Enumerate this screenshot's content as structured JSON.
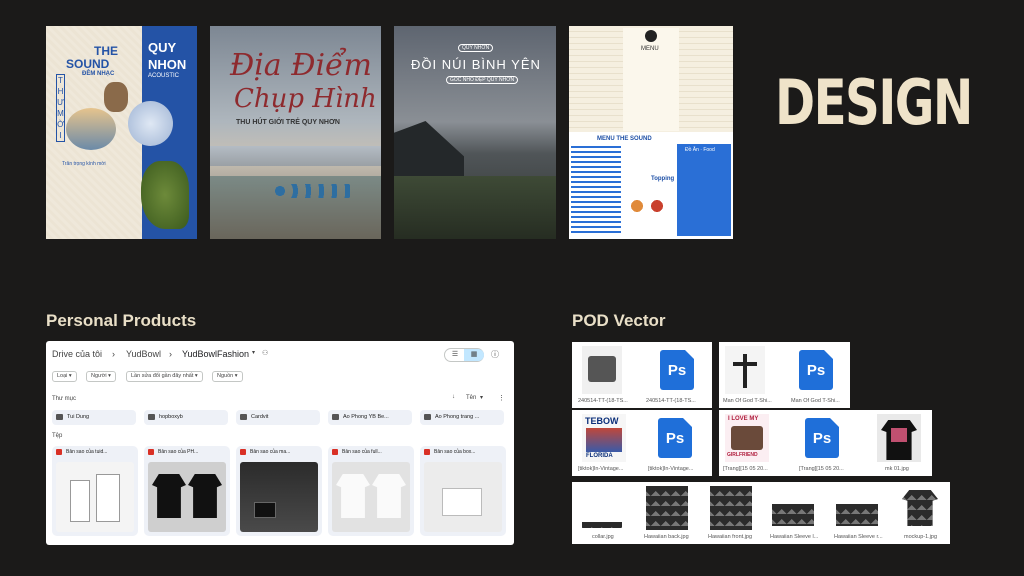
{
  "posters": {
    "p1": {
      "top_left": "THE",
      "sound": "SOUND",
      "dem_nhac": "ĐÊM NHẠC",
      "quy": "QUY",
      "nhon": "NHON",
      "acoustic": "ACOUSTIC",
      "thu_moi": "THƯ MỜI",
      "small": "Trân trọng kính mời"
    },
    "p2": {
      "line1": "Địa Điểm",
      "line2": "Chụp Hình",
      "sub": "THU HÚT GIỚI TRẺ QUY NHƠN"
    },
    "p3": {
      "badge": "QUY NHƠN",
      "title": "ĐỒI NÚI BÌNH YÊN",
      "sub": "GÓC NHỎ ĐẸP QUY NHƠN"
    },
    "p4": {
      "header": "MENU",
      "menu_title": "MENU THE SOUND",
      "food": "Đồ Ăn · Food",
      "topping": "Topping"
    }
  },
  "design_word": "DESIGN",
  "personal_products_title": "Personal Products",
  "pod_vector_title": "POD Vector",
  "drive": {
    "breadcrumb_root": "Drive của tôi",
    "breadcrumb_mid": "YudBowl",
    "breadcrumb_current": "YudBowlFashion",
    "filters": [
      "Loại",
      "Người",
      "Lần sửa đổi gần đây nhất",
      "Nguồn"
    ],
    "sort_label": "Tên",
    "folders_heading": "Thư mục",
    "folders": [
      "Tui Dung",
      "hopboxyb",
      "Cardvit",
      "Ao Phong YB Be...",
      "Ao Phong trang ..."
    ],
    "files_heading": "Tệp",
    "files": [
      "Bản sao của tuid...",
      "Bản sao của PH...",
      "Bản sao của ma...",
      "Bản sao của full...",
      "Bản sao của box..."
    ]
  },
  "pod": {
    "ps_label": "Ps",
    "row1a": [
      "240514-TT-(18-TS...",
      "240514-TT-(18-TS..."
    ],
    "row1b": [
      "Man Of God T-Shi...",
      "Man Of God T-Shi..."
    ],
    "row2a": [
      "[tiktok]In-Vintage...",
      "[tiktok]In-Vintage..."
    ],
    "row2b": [
      "[Trang][15 05 20...",
      "[Trang][15 05 20...",
      "mk 01.jpg"
    ],
    "row3": [
      "collar.jpg",
      "Hawaiian back.jpg",
      "Hawaiian front.jpg",
      "Hawaiian Sleeve l...",
      "Hawaiian Sleeve r...",
      "mockup-1.jpg"
    ],
    "art_text": {
      "tebow": "TEBOW",
      "florida": "FLORIDA",
      "ilove": "I LOVE MY",
      "girlfriend": "GIRLFRIEND"
    }
  },
  "colors": {
    "background": "#1b1a19",
    "title": "#e9dfc7",
    "design": "#efe3c9",
    "ps_blue": "#1f6fd9",
    "poster_blue": "#2453a6"
  }
}
